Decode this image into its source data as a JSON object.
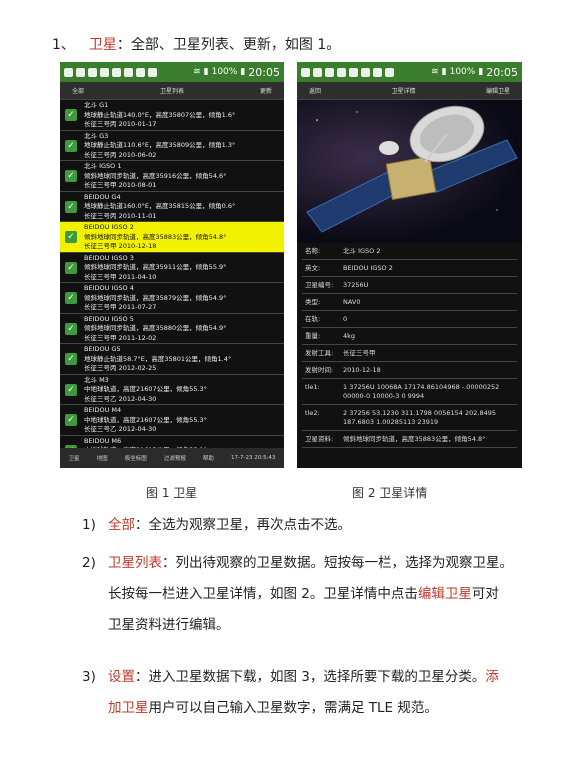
{
  "heading": {
    "number": "1、",
    "term": "卫星",
    "text": "：全部、卫星列表、更新，如图 1。"
  },
  "left_phone": {
    "status_time": "20:05",
    "status_battery": "100%",
    "actionbar": [
      "全部",
      "卫星列表",
      "更新"
    ],
    "items": [
      {
        "name": "北斗 G1",
        "line1": "地球静止轨道140.0°E，高度35807公里，倾角1.6°",
        "line2": "长征三号丙 2010-01-17",
        "selected": false
      },
      {
        "name": "北斗 G3",
        "line1": "地球静止轨道110.6°E，高度35809公里，倾角1.3°",
        "line2": "长征三号丙 2010-06-02",
        "selected": false
      },
      {
        "name": "北斗 IGSO 1",
        "line1": "倾斜地球同步轨道，高度35916公里，倾角54.6°",
        "line2": "长征三号甲 2010-08-01",
        "selected": false
      },
      {
        "name": "BEIDOU G4",
        "line1": "地球静止轨道160.0°E，高度35815公里，倾角0.6°",
        "line2": "长征三号丙 2010-11-01",
        "selected": false
      },
      {
        "name": "BEIDOU IGSO 2",
        "line1": "倾斜地球同步轨道，高度35883公里，倾角54.8°",
        "line2": "长征三号甲 2010-12-18",
        "selected": true
      },
      {
        "name": "BEIDOU IGSO 3",
        "line1": "倾斜地球同步轨道，高度35911公里，倾角55.9°",
        "line2": "长征三号甲 2011-04-10",
        "selected": false
      },
      {
        "name": "BEIDOU IGSO 4",
        "line1": "倾斜地球同步轨道，高度35879公里，倾角54.9°",
        "line2": "长征三号甲 2011-07-27",
        "selected": false
      },
      {
        "name": "BEIDOU IGSO 5",
        "line1": "倾斜地球同步轨道，高度35880公里，倾角54.9°",
        "line2": "长征三号甲 2011-12-02",
        "selected": false
      },
      {
        "name": "BEIDOU G5",
        "line1": "地球静止轨道58.7°E，高度35801公里，倾角1.4°",
        "line2": "长征三号丙 2012-02-25",
        "selected": false
      },
      {
        "name": "北斗 M3",
        "line1": "中地球轨道，高度21607公里，倾角55.3°",
        "line2": "长征三号乙 2012-04-30",
        "selected": false
      },
      {
        "name": "BEIDOU M4",
        "line1": "中地球轨道，高度21607公里，倾角55.3°",
        "line2": "长征三号乙 2012-04-30",
        "selected": false
      },
      {
        "name": "BEIDOU M6",
        "line1": "中地球轨道，高度21615公里，倾角55.1°",
        "line2": "",
        "selected": false
      }
    ],
    "bottombar": [
      "卫星",
      "地图",
      "极坐标图",
      "过滤预报",
      "帮助",
      "17-7-23 20:5:43"
    ]
  },
  "right_phone": {
    "status_time": "20:05",
    "status_battery": "100%",
    "actionbar": [
      "返回",
      "卫星详情",
      "编辑卫星"
    ],
    "details": [
      {
        "label": "名称:",
        "value": "北斗 IGSO 2"
      },
      {
        "label": "英文:",
        "value": "BEIDOU IGSO 2"
      },
      {
        "label": "卫星编号:",
        "value": "37256U"
      },
      {
        "label": "类型:",
        "value": "NAV0"
      },
      {
        "label": "在轨:",
        "value": "0"
      },
      {
        "label": "重量:",
        "value": "4kg"
      },
      {
        "label": "发射工具:",
        "value": "长征三号甲"
      },
      {
        "label": "发射时间:",
        "value": "2010-12-18"
      },
      {
        "label": "tle1:",
        "value": "1 37256U 10068A   17174.86104968 -.00000252 00000-0  10000-3 0  9994"
      },
      {
        "label": "tle2:",
        "value": "2 37256  53.1230 311.1798 0056154 202.8495 187.6803  1.00285113 23919"
      },
      {
        "label": "卫星资料:",
        "value": "倾斜地球同步轨道，高度35883公里，倾角54.8°"
      }
    ]
  },
  "captions": {
    "fig1": "图 1  卫星",
    "fig2": "图 2  卫星详情"
  },
  "items": [
    {
      "num": "1)",
      "term": "全部",
      "text": "：全选为观察卫星，再次点击不选。"
    },
    {
      "num": "2)",
      "term": "卫星列表",
      "text": "：列出待观察的卫星数据。短按每一栏，选择为观察卫星。",
      "cont1": "长按每一栏进入卫星详情，如图  2。卫星详情中点击",
      "term2": "编辑卫星",
      "cont2": "可对",
      "cont3": "卫星资料进行编辑。"
    },
    {
      "num": "3)",
      "term": "设置",
      "text": "：进入卫星数据下载，如图  3，选择所要下载的卫星分类。",
      "term2": "添",
      "term3": "加卫星",
      "cont": "用户可以自己输入卫星数字，需满足 TLE 规范。"
    }
  ]
}
